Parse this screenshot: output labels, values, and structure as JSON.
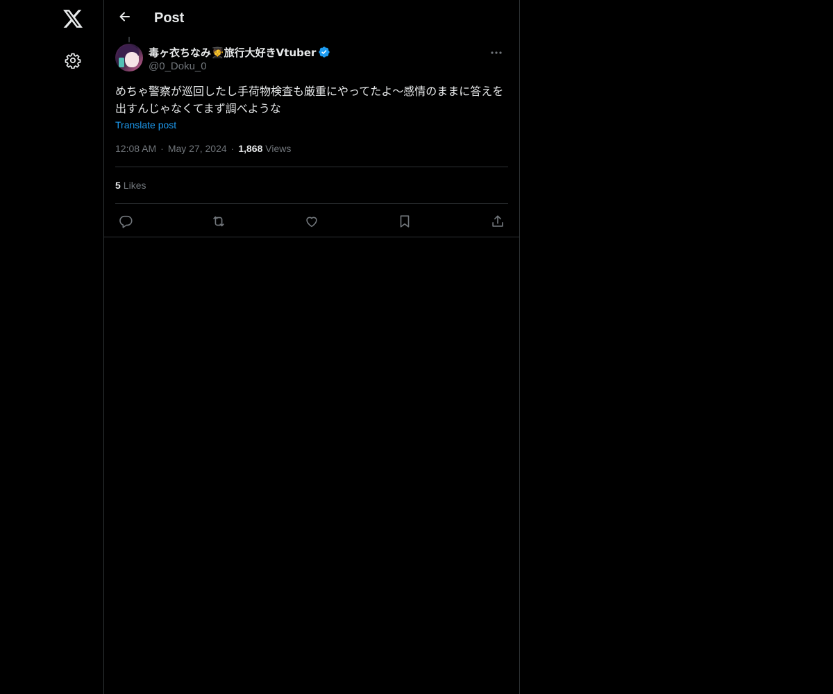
{
  "nav": {
    "logo_icon": "x-logo-icon",
    "settings_icon": "gear-icon"
  },
  "header": {
    "back_icon": "arrow-left-icon",
    "title": "Post"
  },
  "post": {
    "author_name": "毒ヶ衣ちなみ🧑‍🎓旅行大好きVtuber",
    "verified": true,
    "handle": "@0_Doku_0",
    "text": "めちゃ警察が巡回したし手荷物検査も厳重にやってたよ〜感情のままに答えを出すんじゃなくてまず調べような",
    "translate_label": "Translate post",
    "time": "12:08 AM",
    "date": "May 27, 2024",
    "views_count": "1,868",
    "views_label": "Views",
    "likes_count": "5",
    "likes_label": "Likes"
  },
  "actions": {
    "reply_icon": "reply-icon",
    "repost_icon": "repost-icon",
    "like_icon": "heart-icon",
    "bookmark_icon": "bookmark-icon",
    "share_icon": "share-icon"
  },
  "colors": {
    "background": "#000000",
    "text": "#e7e9ea",
    "muted": "#71767b",
    "border": "#2f3336",
    "accent": "#1d9bf0"
  }
}
